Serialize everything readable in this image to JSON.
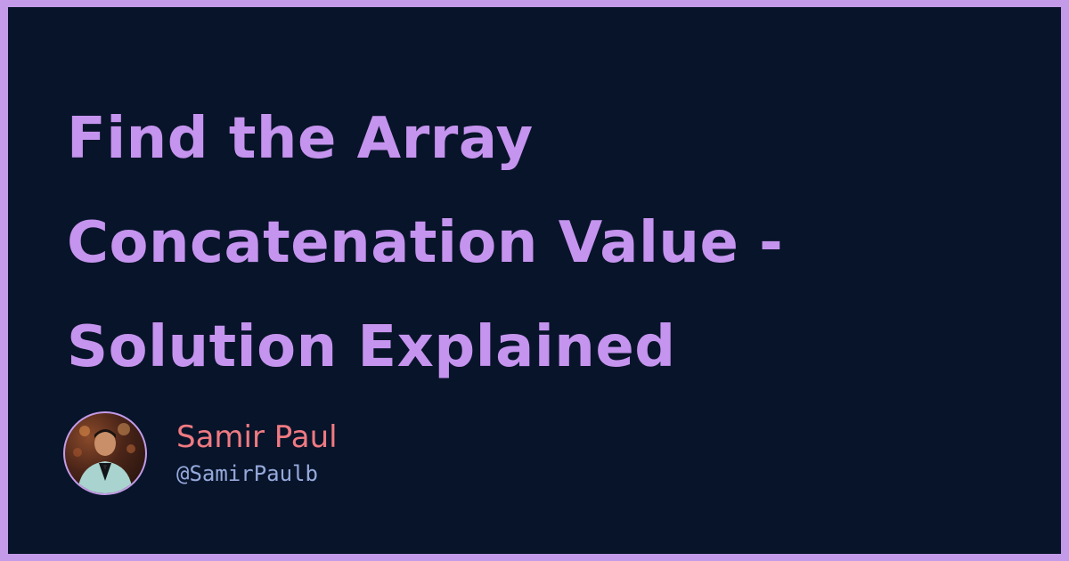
{
  "card": {
    "title_lines": [
      "Find the Array",
      "Concatenation Value -",
      "Solution Explained"
    ],
    "author": {
      "name": "Samir Paul",
      "handle": "@SamirPaulb",
      "avatar_icon": "person-photo-icon"
    }
  },
  "colors": {
    "border": "#c39be8",
    "background": "#08142a",
    "title": "#c594ee",
    "author_name": "#f07a82",
    "author_handle": "#96a9dc"
  }
}
